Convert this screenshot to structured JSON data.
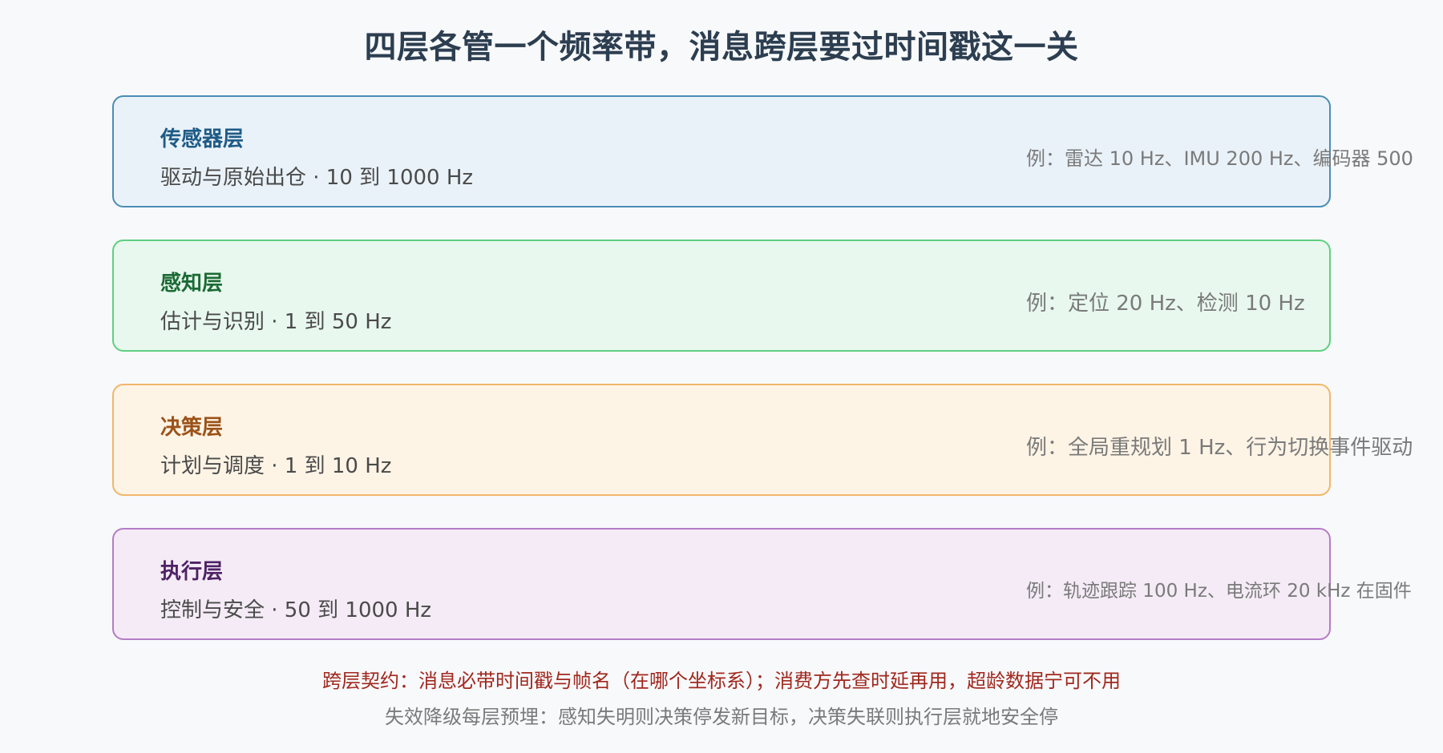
{
  "title": "四层各管一个频率带，消息跨层要过时间戳这一关",
  "layers": [
    {
      "name": "传感器层",
      "desc": "驱动与原始出仓 · 10 到 1000 Hz",
      "example": "例：雷达 10 Hz、IMU 200 Hz、编码器 500",
      "colors": {
        "border": "#4a8db5",
        "fill": "#eaf2f9",
        "name": "#1f5b86"
      }
    },
    {
      "name": "感知层",
      "desc": "估计与识别 · 1 到 50 Hz",
      "example": "例：定位 20 Hz、检测 10 Hz",
      "colors": {
        "border": "#5fcf80",
        "fill": "#e8f8ee",
        "name": "#1c6b35"
      }
    },
    {
      "name": "决策层",
      "desc": "计划与调度 · 1 到 10 Hz",
      "example": "例：全局重规划 1 Hz、行为切换事件驱动",
      "colors": {
        "border": "#f0b66a",
        "fill": "#fef4e6",
        "name": "#9b5218"
      }
    },
    {
      "name": "执行层",
      "desc": "控制与安全 · 50 到 1000 Hz",
      "example": "例：轨迹跟踪 100 Hz、电流环 20 kHz 在固件",
      "colors": {
        "border": "#b57cc6",
        "fill": "#f4ebf6",
        "name": "#4e2266"
      }
    }
  ],
  "footer": {
    "contract": "跨层契约：消息必带时间戳与帧名（在哪个坐标系）；消费方先查时延再用，超龄数据宁可不用",
    "fallback": "失效降级每层预埋：感知失明则决策停发新目标，决策失联则执行层就地安全停"
  }
}
